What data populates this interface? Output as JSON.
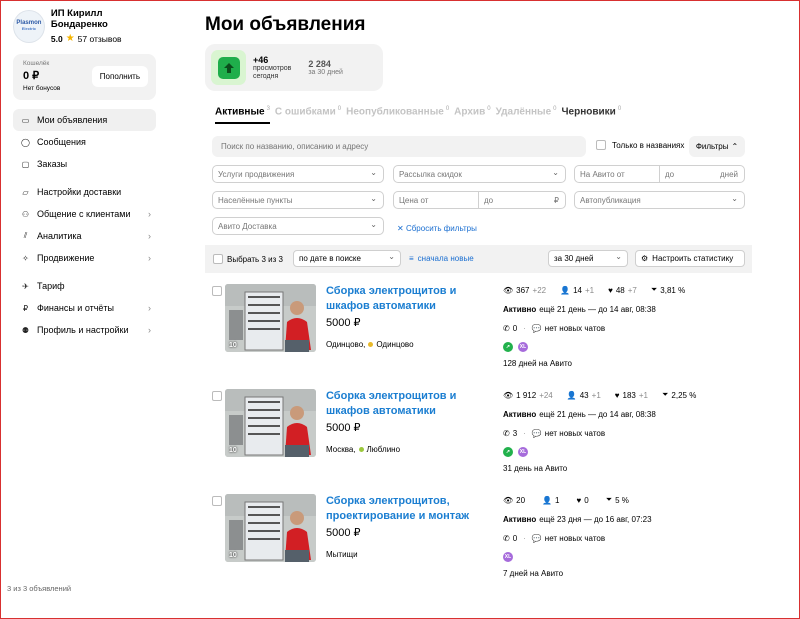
{
  "profile": {
    "name": "ИП Кирилл Бондаренко",
    "rating": "5.0",
    "reviews": "57 отзывов",
    "logo_line1": "Plasmon",
    "logo_line2": "Electric"
  },
  "wallet": {
    "label": "Кошелёк",
    "amount": "0 ₽",
    "bonus": "Нет бонусов",
    "topup": "Пополнить"
  },
  "menu": [
    {
      "label": "Мои объявления",
      "icon": "listings-icon"
    },
    {
      "label": "Сообщения",
      "icon": "chat-icon"
    },
    {
      "label": "Заказы",
      "icon": "box-icon"
    },
    {
      "label": "Настройки доставки",
      "icon": "truck-icon"
    },
    {
      "label": "Общение с клиентами",
      "icon": "people-icon"
    },
    {
      "label": "Аналитика",
      "icon": "chart-icon"
    },
    {
      "label": "Продвижение",
      "icon": "rocket-icon"
    },
    {
      "label": "Тариф",
      "icon": "plane-icon"
    },
    {
      "label": "Финансы и отчёты",
      "icon": "ruble-icon"
    },
    {
      "label": "Профиль и настройки",
      "icon": "user-icon"
    }
  ],
  "page": {
    "title": "Мои объявления"
  },
  "stats": {
    "views_value": "+46",
    "views_desc1": "просмотров",
    "views_desc2": "сегодня",
    "month_value": "2 284",
    "month_desc": "за 30 дней"
  },
  "tabs": [
    {
      "label": "Активные",
      "count": "3"
    },
    {
      "label": "С ошибками",
      "count": "0"
    },
    {
      "label": "Неопубликованные",
      "count": "0"
    },
    {
      "label": "Архив",
      "count": "0"
    },
    {
      "label": "Удалённые",
      "count": "0"
    },
    {
      "label": "Черновики",
      "count": "0"
    }
  ],
  "search": {
    "placeholder": "Поиск по названию, описанию и адресу",
    "only_names": "Только в названиях",
    "filters": "Фильтры"
  },
  "filters": {
    "promo": "Услуги продвижения",
    "discounts": "Рассылка скидок",
    "on_avito_from": "На Авито от",
    "to": "до",
    "days": "дней",
    "settlements": "Населённые пункты",
    "price_from": "Цена от",
    "price_to": "до",
    "currency": "₽",
    "autopublish": "Автопубликация",
    "delivery": "Авито Доставка",
    "reset": "Сбросить фильтры"
  },
  "toolbar": {
    "select": "Выбрать 3 из 3",
    "sort": "по дате в поиске",
    "order": "сначала новые",
    "period": "за 30 дней",
    "configure": "Настроить статистику"
  },
  "listings": [
    {
      "title": "Сборка электрощитов и шкафов автоматики",
      "price": "5000 ₽",
      "location": "Одинцово,",
      "metro": "Одинцово",
      "metro_color": "#e8b92a",
      "photos": "10",
      "views": "367",
      "views_delta": "+22",
      "contacts": "14",
      "contacts_delta": "+1",
      "favs": "48",
      "favs_delta": "+7",
      "conversion": "3,81 %",
      "status": "Активно",
      "status_rest": "ещё 21 день — до 14 авг, 08:38",
      "calls": "0",
      "chats": "нет новых чатов",
      "days_on": "128 дней на Авито"
    },
    {
      "title": "Сборка электрощитов и шкафов автоматики",
      "price": "5000 ₽",
      "location": "Москва,",
      "metro": "Люблино",
      "metro_color": "#9bc83b",
      "photos": "10",
      "views": "1 912",
      "views_delta": "+24",
      "contacts": "43",
      "contacts_delta": "+1",
      "favs": "183",
      "favs_delta": "+1",
      "conversion": "2,25 %",
      "status": "Активно",
      "status_rest": "ещё 21 день — до 14 авг, 08:38",
      "calls": "3",
      "chats": "нет новых чатов",
      "days_on": "31 день на Авито"
    },
    {
      "title": "Сборка электрощитов, проектирование и монтаж",
      "price": "5000 ₽",
      "location": "Мытищи",
      "metro": "",
      "metro_color": "",
      "photos": "10",
      "views": "20",
      "views_delta": "",
      "contacts": "1",
      "contacts_delta": "",
      "favs": "0",
      "favs_delta": "",
      "conversion": "5 %",
      "status": "Активно",
      "status_rest": "ещё 23 дня — до 16 авг, 07:23",
      "calls": "0",
      "chats": "нет новых чатов",
      "days_on": "7 дней на Авито"
    }
  ],
  "footer": "3 из 3 объявлений",
  "colors": {
    "accent": "#1b7ed1",
    "green": "#1fae4b",
    "star": "#f5b400"
  }
}
